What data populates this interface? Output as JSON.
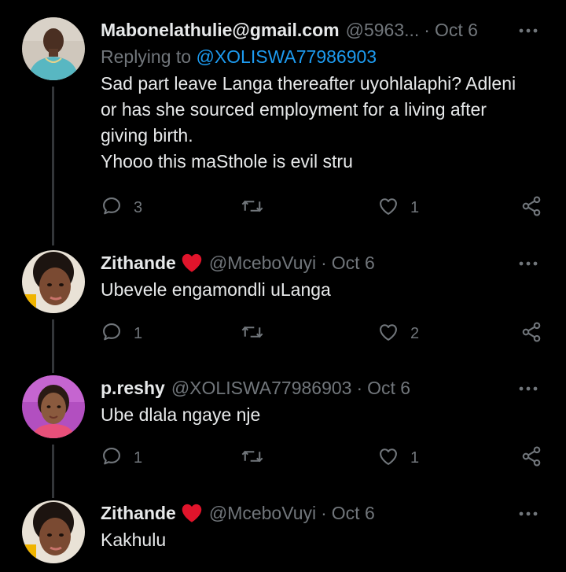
{
  "tweets": [
    {
      "name": "Mabonelathulie@gmail.com",
      "handle": "@5963...",
      "date": "Oct 6",
      "replying_label": "Replying to ",
      "replying_to": "@XOLISWA77986903",
      "text": "Sad part leave Langa thereafter uyohlalaphi? Adleni\nor has she sourced employment for a living after\ngiving birth.\nYhooo this maSthole is evil stru",
      "replies": "3",
      "retweets": "",
      "likes": "1"
    },
    {
      "name": "Zithande",
      "handle": "@MceboVuyi",
      "date": "Oct 6",
      "text": "Ubevele engamondli uLanga",
      "replies": "1",
      "retweets": "",
      "likes": "2"
    },
    {
      "name": "p.reshy",
      "handle": "@XOLISWA77986903",
      "date": "Oct 6",
      "text": "Ube dlala ngaye nje",
      "replies": "1",
      "retweets": "",
      "likes": "1"
    },
    {
      "name": "Zithande",
      "handle": "@MceboVuyi",
      "date": "Oct 6",
      "text": "Kakhulu"
    }
  ],
  "separator": "·",
  "icons": {
    "more": "more-horizontal-icon",
    "reply": "reply-bubble-icon",
    "retweet": "retweet-icon",
    "like": "heart-outline-icon",
    "share": "share-icon",
    "badge": "red-heart-icon"
  },
  "colors": {
    "background": "#000000",
    "text": "#e7e9ea",
    "muted": "#71767b",
    "link": "#1d9bf0",
    "heart": "#f91880",
    "thread_line": "#333639"
  }
}
